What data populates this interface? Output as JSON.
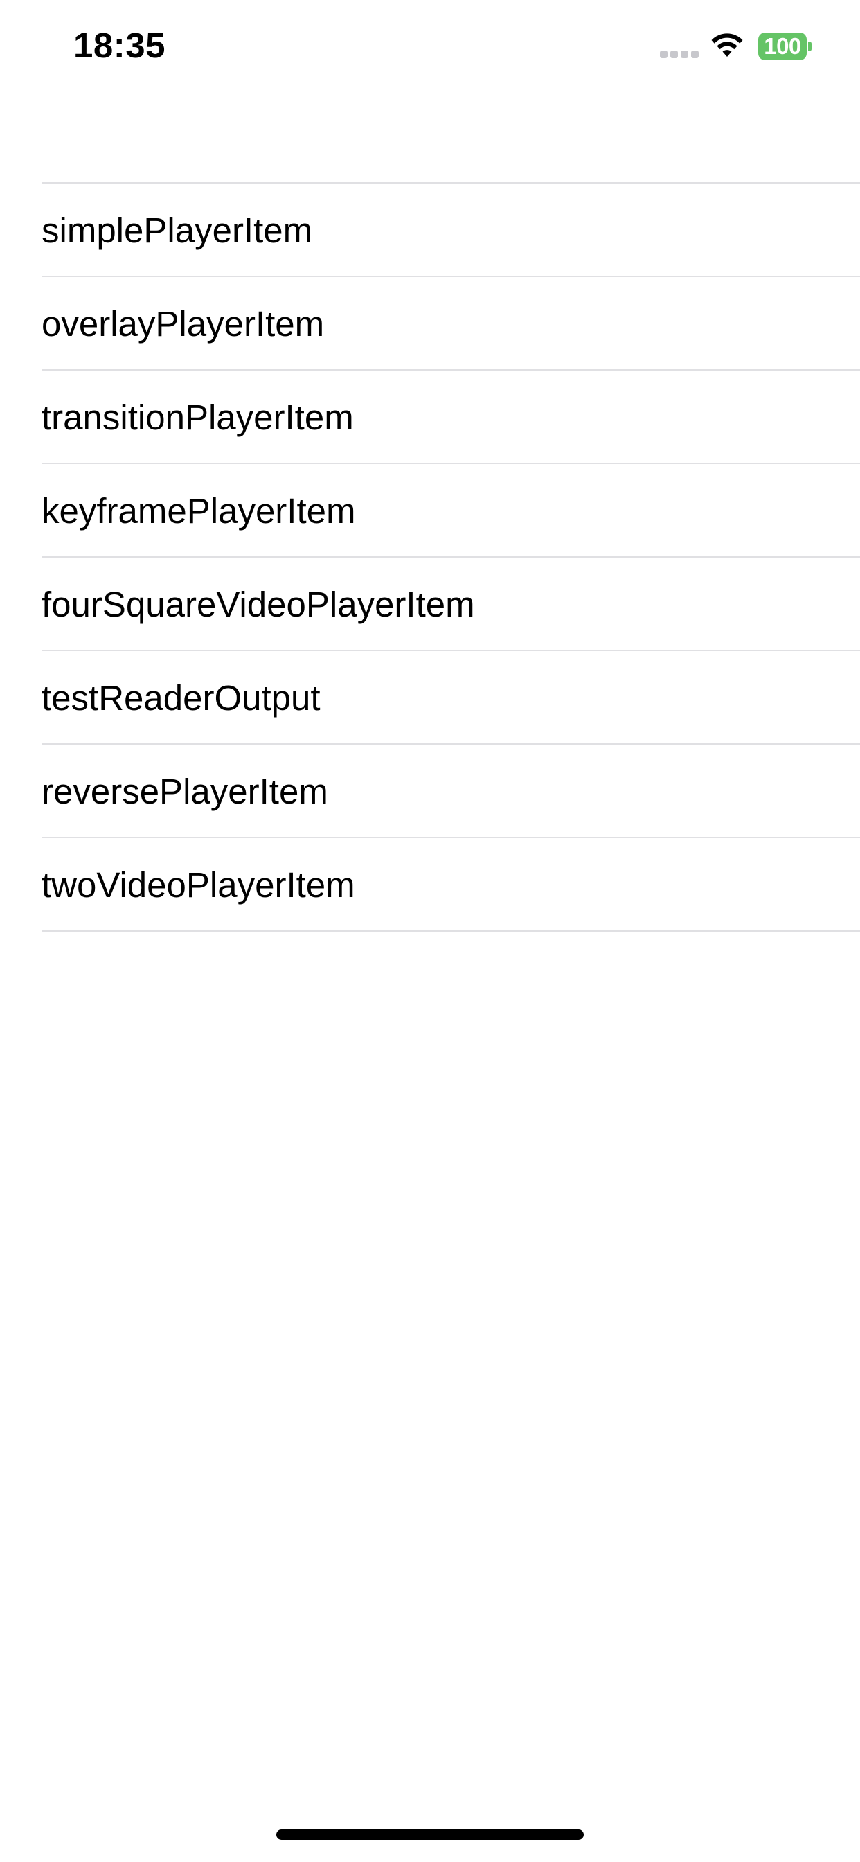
{
  "status_bar": {
    "time": "18:35",
    "battery_level": "100",
    "battery_color": "#65c466",
    "icons": [
      "signal-dots-icon",
      "wifi-icon",
      "battery-icon"
    ]
  },
  "list": {
    "items": [
      {
        "label": "simplePlayerItem"
      },
      {
        "label": "overlayPlayerItem"
      },
      {
        "label": "transitionPlayerItem"
      },
      {
        "label": "keyframePlayerItem"
      },
      {
        "label": "fourSquareVideoPlayerItem"
      },
      {
        "label": "testReaderOutput"
      },
      {
        "label": "reversePlayerItem"
      },
      {
        "label": "twoVideoPlayerItem"
      }
    ]
  }
}
